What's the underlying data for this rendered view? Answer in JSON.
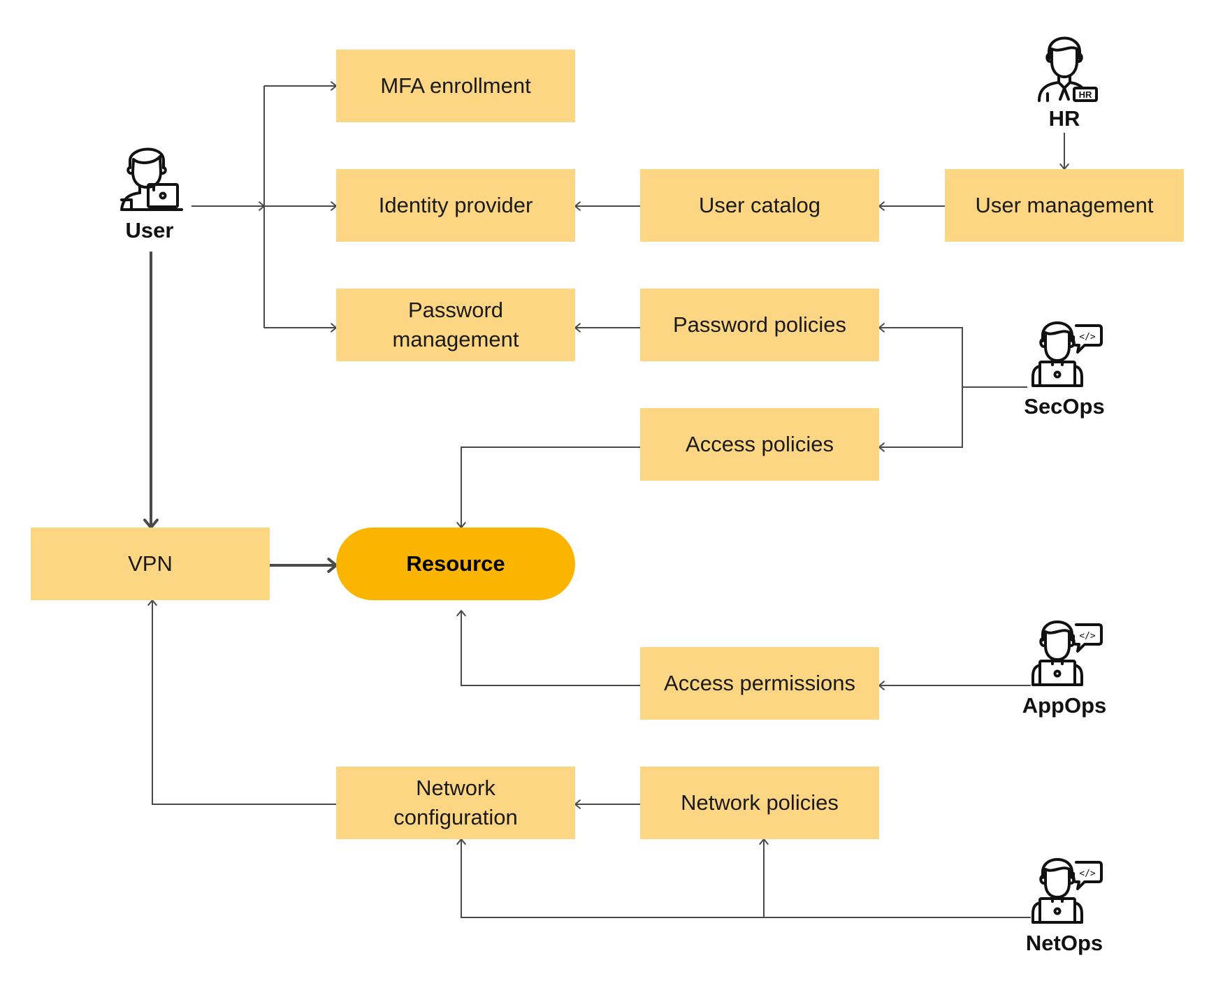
{
  "diagram": {
    "title": "",
    "colors": {
      "box": "#fdd683",
      "resource": "#fbb400",
      "line": "#4a4a4a",
      "text": "#1a1a1a"
    },
    "nodes": {
      "mfa": "MFA enrollment",
      "idp": "Identity provider",
      "pwdmgmt": "Password\nmanagement",
      "catalog": "User catalog",
      "usermgmt": "User management",
      "pwdpol": "Password policies",
      "accpol": "Access policies",
      "vpn": "VPN",
      "resource": "Resource",
      "accperm": "Access permissions",
      "netcfg": "Network\nconfiguration",
      "netpol": "Network policies"
    },
    "actors": {
      "user": {
        "label": "User",
        "icon": "user-laptop-icon"
      },
      "hr": {
        "label": "HR",
        "icon": "hr-person-icon"
      },
      "secops": {
        "label": "SecOps",
        "icon": "developer-code-icon"
      },
      "appops": {
        "label": "AppOps",
        "icon": "developer-code-icon"
      },
      "netops": {
        "label": "NetOps",
        "icon": "developer-code-icon"
      }
    },
    "edges": [
      {
        "from": "User",
        "to": "MFA enrollment"
      },
      {
        "from": "User",
        "to": "Identity provider"
      },
      {
        "from": "User",
        "to": "Password management"
      },
      {
        "from": "User",
        "to": "VPN",
        "emphasis": true
      },
      {
        "from": "HR",
        "to": "User management"
      },
      {
        "from": "User management",
        "to": "User catalog"
      },
      {
        "from": "User catalog",
        "to": "Identity provider"
      },
      {
        "from": "Password policies",
        "to": "Password management"
      },
      {
        "from": "SecOps",
        "to": "Password policies"
      },
      {
        "from": "SecOps",
        "to": "Access policies"
      },
      {
        "from": "Access policies",
        "to": "Resource"
      },
      {
        "from": "VPN",
        "to": "Resource",
        "emphasis": true
      },
      {
        "from": "AppOps",
        "to": "Access permissions"
      },
      {
        "from": "Access permissions",
        "to": "Resource"
      },
      {
        "from": "Network policies",
        "to": "Network configuration"
      },
      {
        "from": "Network configuration",
        "to": "VPN"
      },
      {
        "from": "NetOps",
        "to": "Network configuration"
      },
      {
        "from": "NetOps",
        "to": "Network policies"
      }
    ]
  }
}
